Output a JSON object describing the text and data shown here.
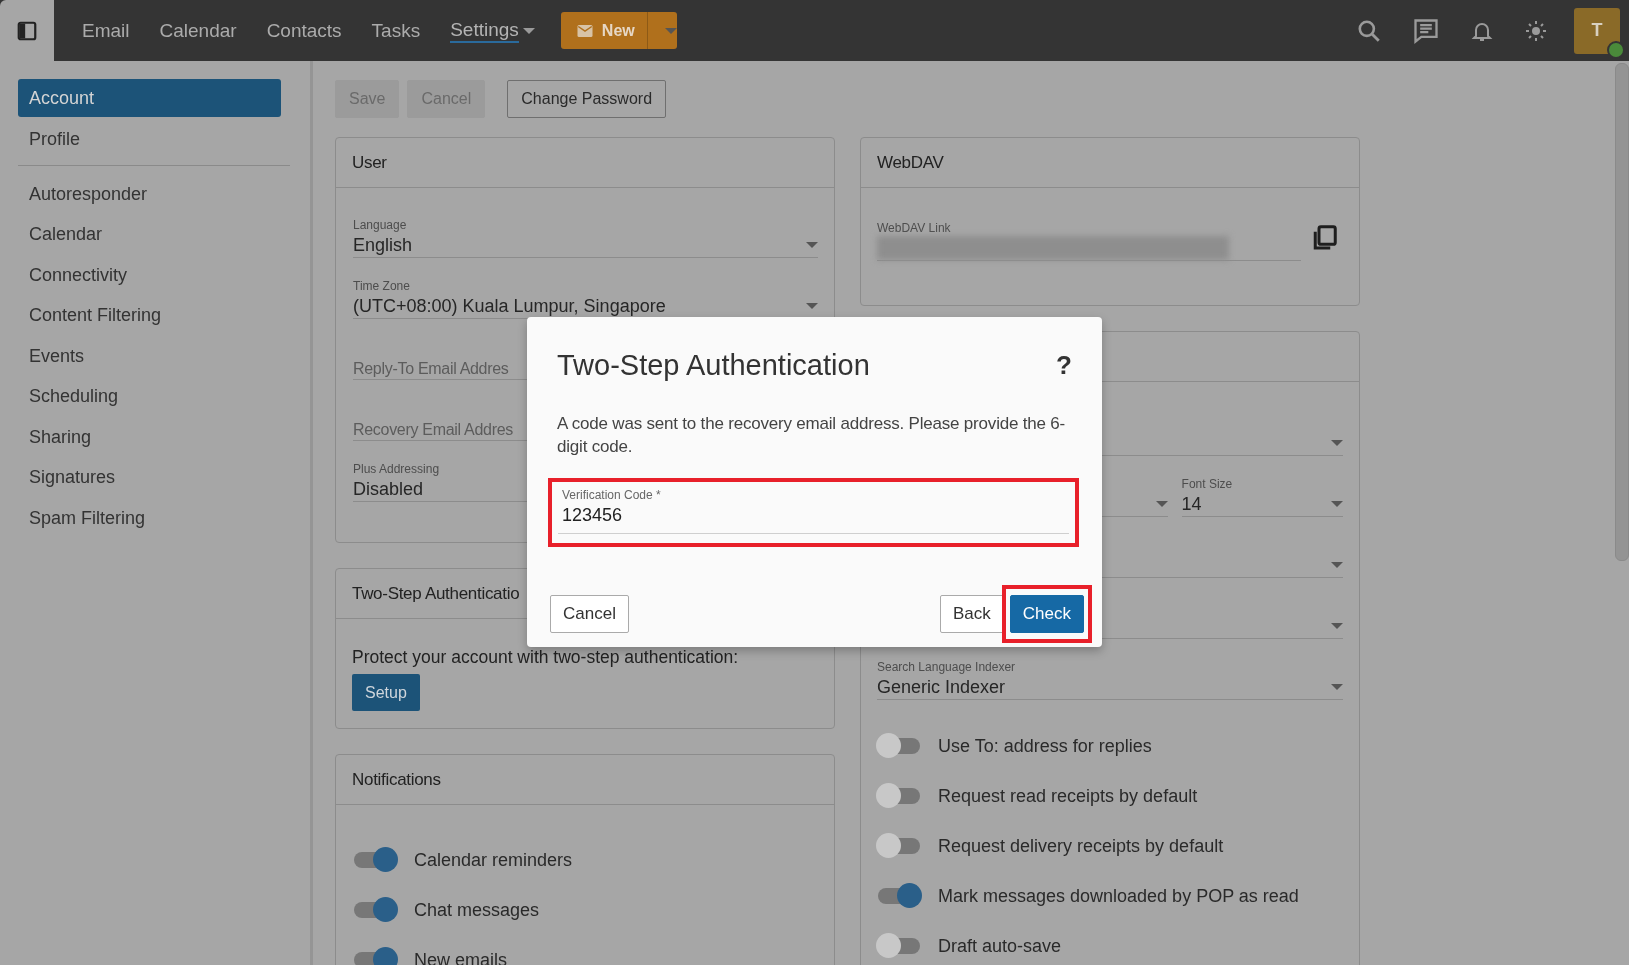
{
  "topbar": {
    "nav": [
      {
        "label": "Email",
        "selected": false,
        "dropdown": false
      },
      {
        "label": "Calendar",
        "selected": false,
        "dropdown": false
      },
      {
        "label": "Contacts",
        "selected": false,
        "dropdown": false
      },
      {
        "label": "Tasks",
        "selected": false,
        "dropdown": false
      },
      {
        "label": "Settings",
        "selected": true,
        "dropdown": true
      }
    ],
    "new_button": {
      "label": "New"
    },
    "avatar": {
      "initial": "T",
      "online": true
    }
  },
  "sidebar": {
    "groups": [
      [
        {
          "label": "Account",
          "selected": true
        },
        {
          "label": "Profile",
          "selected": false
        }
      ],
      [
        {
          "label": "Autoresponder",
          "selected": false
        },
        {
          "label": "Calendar",
          "selected": false
        },
        {
          "label": "Connectivity",
          "selected": false
        },
        {
          "label": "Content Filtering",
          "selected": false
        },
        {
          "label": "Events",
          "selected": false
        },
        {
          "label": "Scheduling",
          "selected": false
        },
        {
          "label": "Sharing",
          "selected": false
        },
        {
          "label": "Signatures",
          "selected": false
        },
        {
          "label": "Spam Filtering",
          "selected": false
        }
      ]
    ]
  },
  "toolbar": {
    "buttons": [
      {
        "label": "Save",
        "disabled": true
      },
      {
        "label": "Cancel",
        "disabled": true
      },
      {
        "label": "Change Password",
        "disabled": false
      }
    ]
  },
  "user_card": {
    "title": "User",
    "fields": [
      {
        "kind": "select",
        "label": "Language",
        "value": "English"
      },
      {
        "kind": "select",
        "label": "Time Zone",
        "value": "(UTC+08:00) Kuala Lumpur, Singapore"
      },
      {
        "kind": "text",
        "placeholder": "Reply-To Email Addres"
      },
      {
        "kind": "text",
        "placeholder": "Recovery Email Addres"
      },
      {
        "kind": "text",
        "label": "Plus Addressing",
        "value": "Disabled"
      }
    ]
  },
  "two_step_card": {
    "title": "Two-Step Authenticatio",
    "text": "Protect your account with two-step authentication:",
    "button": "Setup"
  },
  "notifications_card": {
    "title": "Notifications",
    "toggles": [
      {
        "label": "Calendar reminders",
        "on": true
      },
      {
        "label": "Chat messages",
        "on": true
      },
      {
        "label": "New emails",
        "on": true
      }
    ]
  },
  "webdav_card": {
    "title": "WebDAV",
    "link_label": "WebDAV Link"
  },
  "mail_card": {
    "rows": [
      [
        {
          "kind": "select"
        }
      ],
      [
        {
          "kind": "select"
        },
        {
          "kind": "select",
          "label": "Font Size",
          "value": "14"
        }
      ],
      [
        {
          "kind": "select"
        }
      ],
      [
        {
          "kind": "select"
        }
      ],
      [
        {
          "kind": "select",
          "label": "Search Language Indexer",
          "value": "Generic Indexer"
        }
      ]
    ],
    "toggles": [
      {
        "label": "Use To: address for replies",
        "on": false
      },
      {
        "label": "Request read receipts by default",
        "on": false
      },
      {
        "label": "Request delivery receipts by default",
        "on": false
      },
      {
        "label": "Mark messages downloaded by POP as read",
        "on": true
      },
      {
        "label": "Draft auto-save",
        "on": false
      }
    ]
  },
  "dialog": {
    "title": "Two-Step Authentication",
    "help": "?",
    "message": "A code was sent to the recovery email address. Please provide the 6-digit code.",
    "field": {
      "label": "Verification Code *",
      "value": "123456",
      "highlighted": true
    },
    "buttons": [
      {
        "label": "Cancel",
        "kind": "secondary",
        "highlighted": false
      },
      {
        "label": "Back",
        "kind": "secondary",
        "highlighted": false
      },
      {
        "label": "Check",
        "kind": "primary",
        "highlighted": true
      }
    ]
  }
}
